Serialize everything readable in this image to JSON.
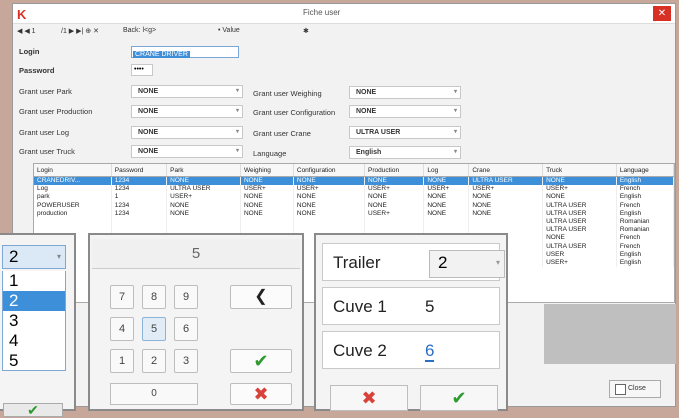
{
  "window": {
    "title": "Fiche user",
    "close_glyph": "✕",
    "icon": "K"
  },
  "toolbar": {
    "nav": "◀ ◀ 1",
    "page_of": "/1 ▶ ▶| ⊕ ✕",
    "back": "Back: l<g>",
    "value_label": "• Value",
    "star": "✱"
  },
  "form": {
    "login_label": "Login",
    "login_value": "CRANE DRIVER",
    "password_label": "Password",
    "password_value": "••••",
    "left": [
      {
        "label": "Grant user Park",
        "value": "NONE"
      },
      {
        "label": "Grant user Production",
        "value": "NONE"
      },
      {
        "label": "Grant user Log",
        "value": "NONE"
      },
      {
        "label": "Grant user Truck",
        "value": "NONE"
      }
    ],
    "right": [
      {
        "label": "Grant user Weighing",
        "value": "NONE"
      },
      {
        "label": "Grant user Configuration",
        "value": "NONE"
      },
      {
        "label": "Grant user Crane",
        "value": "ULTRA USER"
      },
      {
        "label": "Language",
        "value": "English"
      }
    ]
  },
  "table": {
    "headers": [
      "Login",
      "Password",
      "Park",
      "Weighing",
      "Configuration",
      "Production",
      "Log",
      "Crane",
      "Truck",
      "Language"
    ],
    "rows": [
      [
        "CRANEDRIV...",
        "1234",
        "NONE",
        "NONE",
        "NONE",
        "NONE",
        "NONE",
        "ULTRA USER",
        "NONE",
        "English"
      ],
      [
        "Log",
        "1234",
        "ULTRA USER",
        "USER+",
        "USER+",
        "USER+",
        "USER+",
        "USER+",
        "USER+",
        "French"
      ],
      [
        "park",
        "1",
        "USER+",
        "NONE",
        "NONE",
        "NONE",
        "NONE",
        "NONE",
        "NONE",
        "English"
      ],
      [
        "POWERUSER",
        "1234",
        "NONE",
        "NONE",
        "NONE",
        "NONE",
        "NONE",
        "NONE",
        "ULTRA USER",
        "French"
      ],
      [
        "production",
        "1234",
        "NONE",
        "NONE",
        "NONE",
        "USER+",
        "NONE",
        "NONE",
        "ULTRA USER",
        "English"
      ],
      [
        "",
        "",
        "",
        "",
        "",
        "",
        "",
        "",
        "ULTRA USER",
        "Romanian"
      ],
      [
        "",
        "",
        "",
        "",
        "",
        "",
        "",
        "",
        "ULTRA USER",
        "Romanian"
      ],
      [
        "",
        "",
        "",
        "",
        "",
        "",
        "",
        "",
        "NONE",
        "French"
      ],
      [
        "",
        "",
        "",
        "",
        "",
        "",
        "",
        "",
        "ULTRA USER",
        "French"
      ],
      [
        "",
        "",
        "",
        "",
        "",
        "",
        "",
        "",
        "USER",
        "English"
      ],
      [
        "",
        "",
        "",
        "",
        "",
        "",
        "",
        "",
        "USER+",
        "English"
      ]
    ]
  },
  "close_label": "Close",
  "dropdown": {
    "selected": "2",
    "options": [
      "1",
      "2",
      "3",
      "4",
      "5"
    ],
    "ok": "✔"
  },
  "keypad": {
    "display": "5",
    "keys": [
      "7",
      "8",
      "9",
      "4",
      "5",
      "6",
      "1",
      "2",
      "3"
    ],
    "zero": "0",
    "backspace": "❮",
    "ok": "✔",
    "cancel": "✖"
  },
  "trailer": {
    "trailer_label": "Trailer",
    "trailer_value": "2",
    "cuve1_label": "Cuve 1",
    "cuve1_value": "5",
    "cuve2_label": "Cuve 2",
    "cuve2_value": "6",
    "cancel": "✖",
    "ok": "✔"
  }
}
